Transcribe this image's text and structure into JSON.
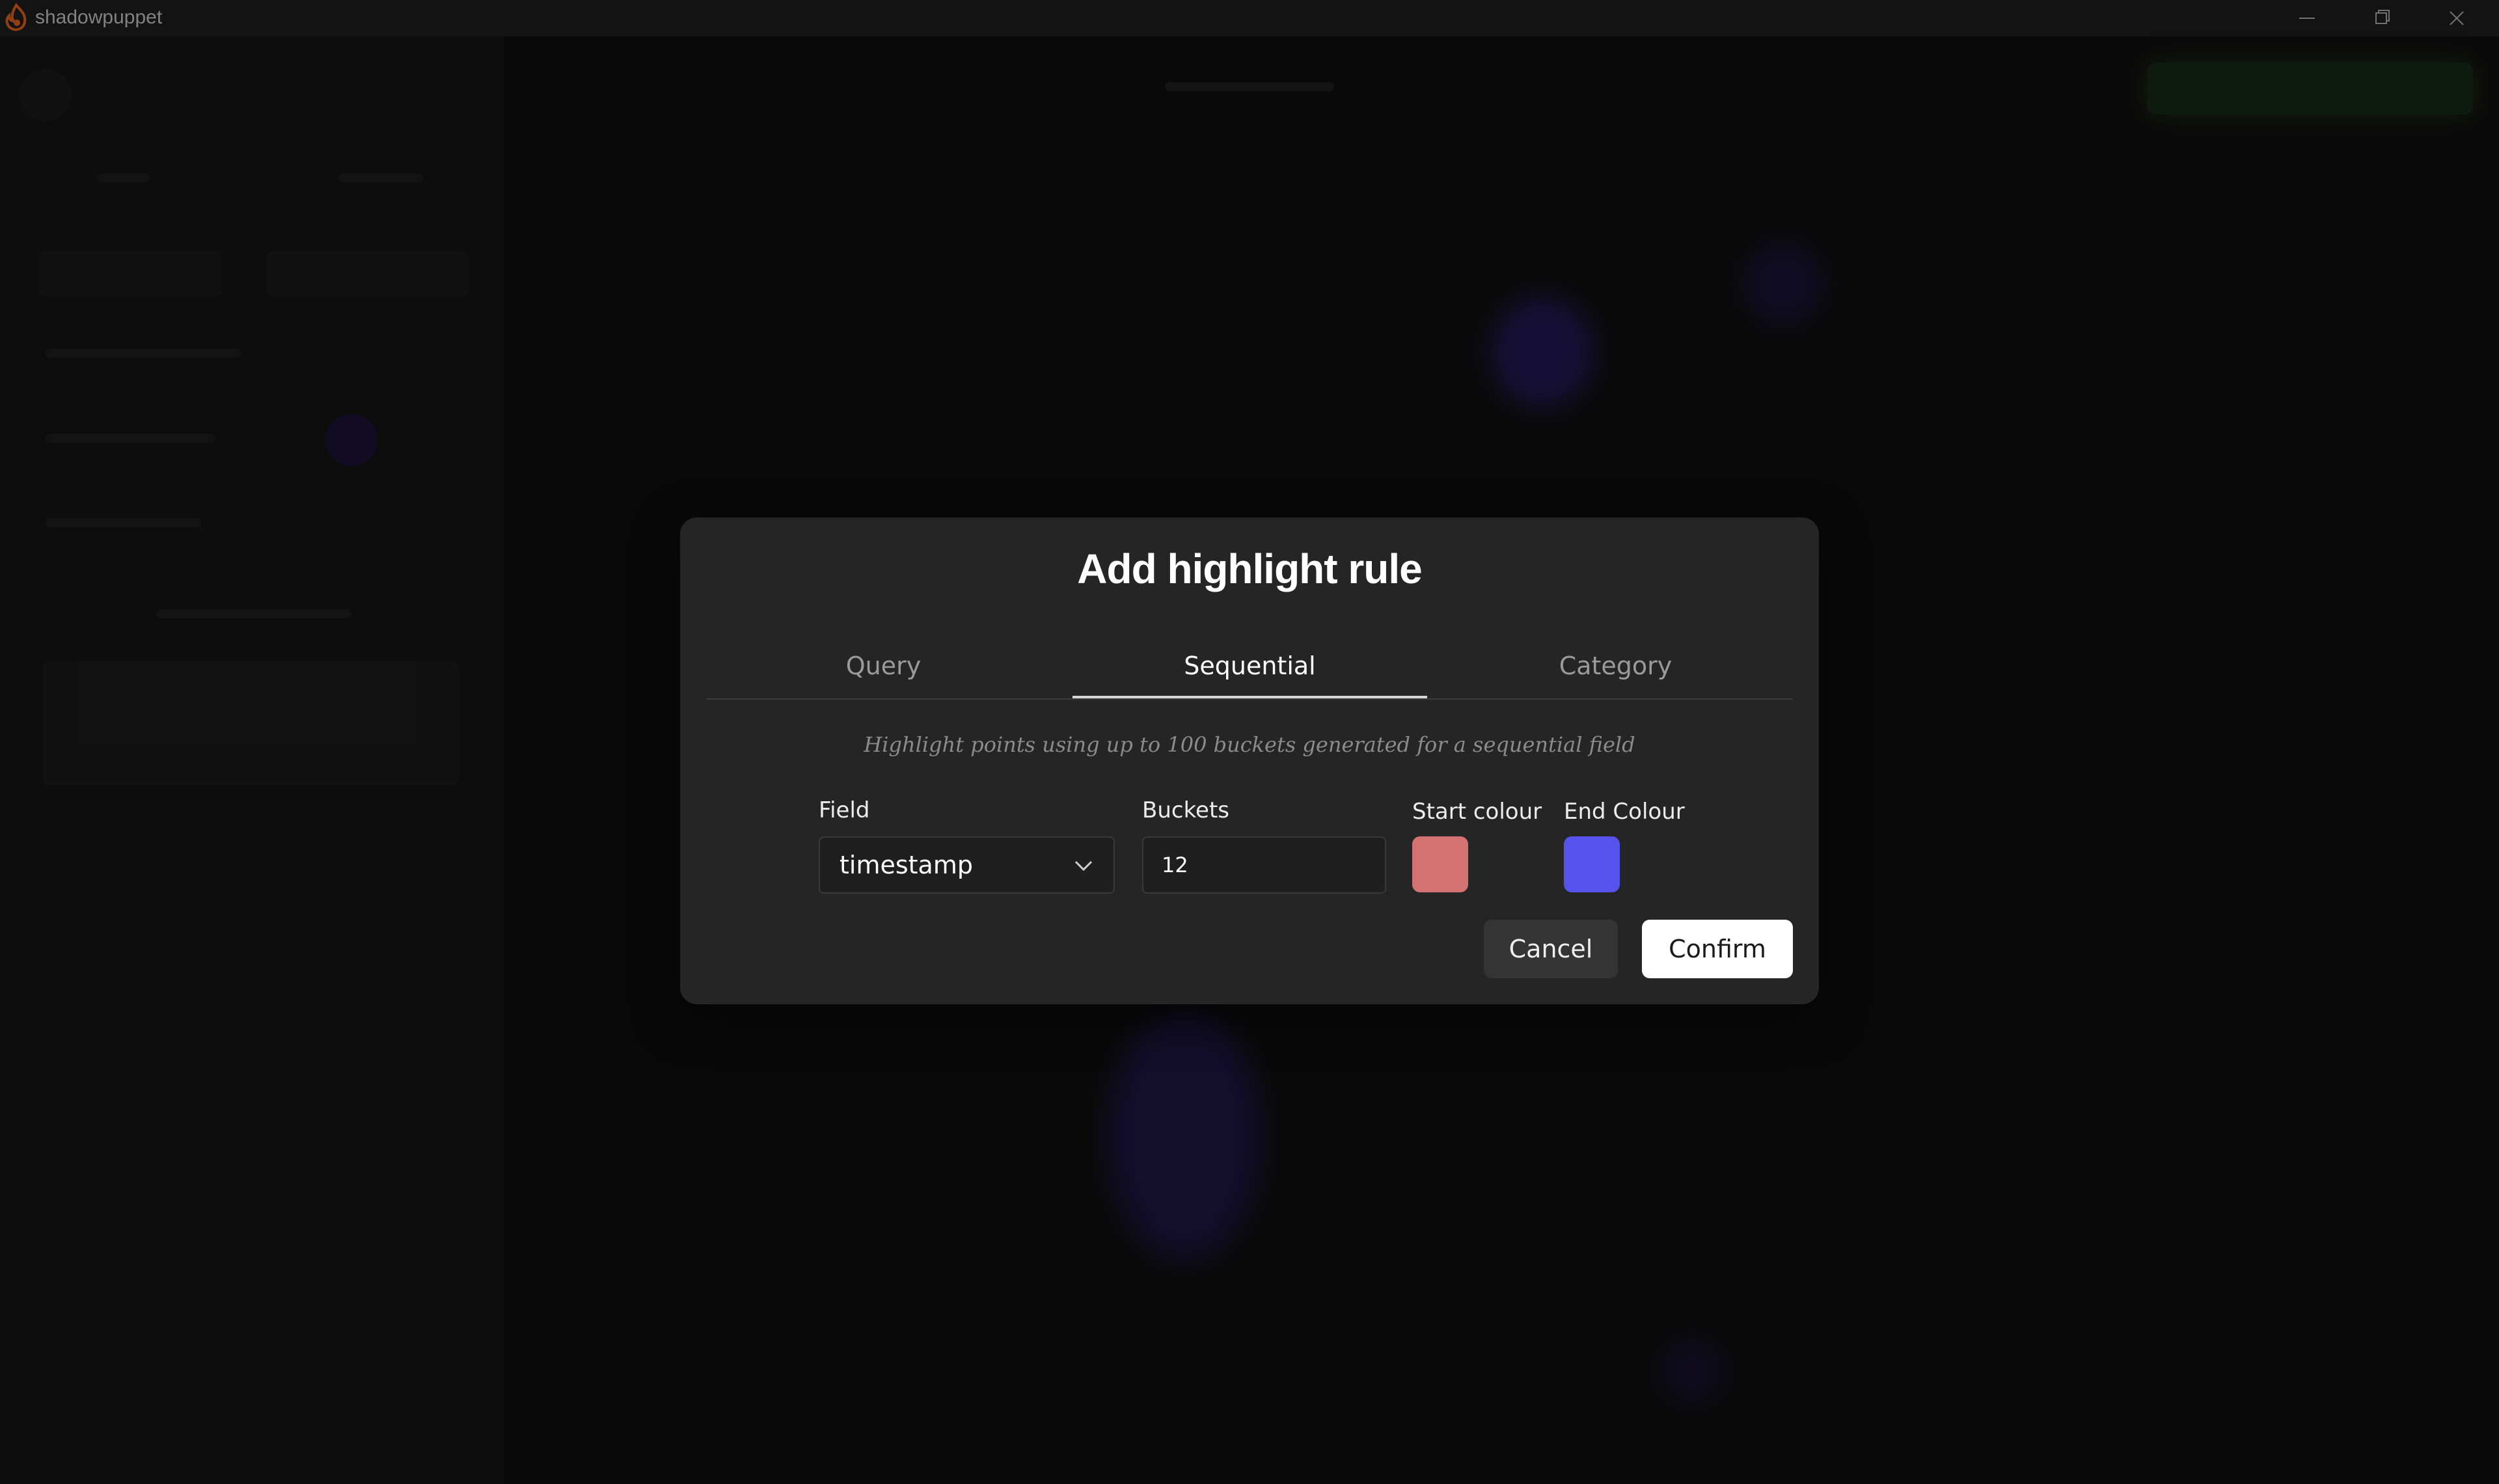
{
  "app": {
    "name": "shadowpuppet",
    "logo_icon": "flame-logo-icon"
  },
  "window_controls": {
    "minimize_icon": "minimize-icon",
    "restore_icon": "restore-icon",
    "close_icon": "close-icon"
  },
  "modal": {
    "title": "Add highlight rule",
    "tabs": [
      {
        "label": "Query",
        "active": false
      },
      {
        "label": "Sequential",
        "active": true
      },
      {
        "label": "Category",
        "active": false
      }
    ],
    "description": "Highlight points using up to 100 buckets generated for a sequential field",
    "field": {
      "label": "Field",
      "value": "timestamp",
      "dropdown_icon": "chevron-down-icon"
    },
    "buckets": {
      "label": "Buckets",
      "value": "12"
    },
    "start_colour": {
      "label": "Start colour",
      "color": "#d47272"
    },
    "end_colour": {
      "label": "End Colour",
      "color": "#5553eb"
    },
    "cancel_label": "Cancel",
    "confirm_label": "Confirm"
  },
  "colors": {
    "modal_background": "#252525",
    "title_bar": "#1e1e1e",
    "logo_orange": "#e0631c",
    "accent_blob": "#4a2ad6"
  }
}
